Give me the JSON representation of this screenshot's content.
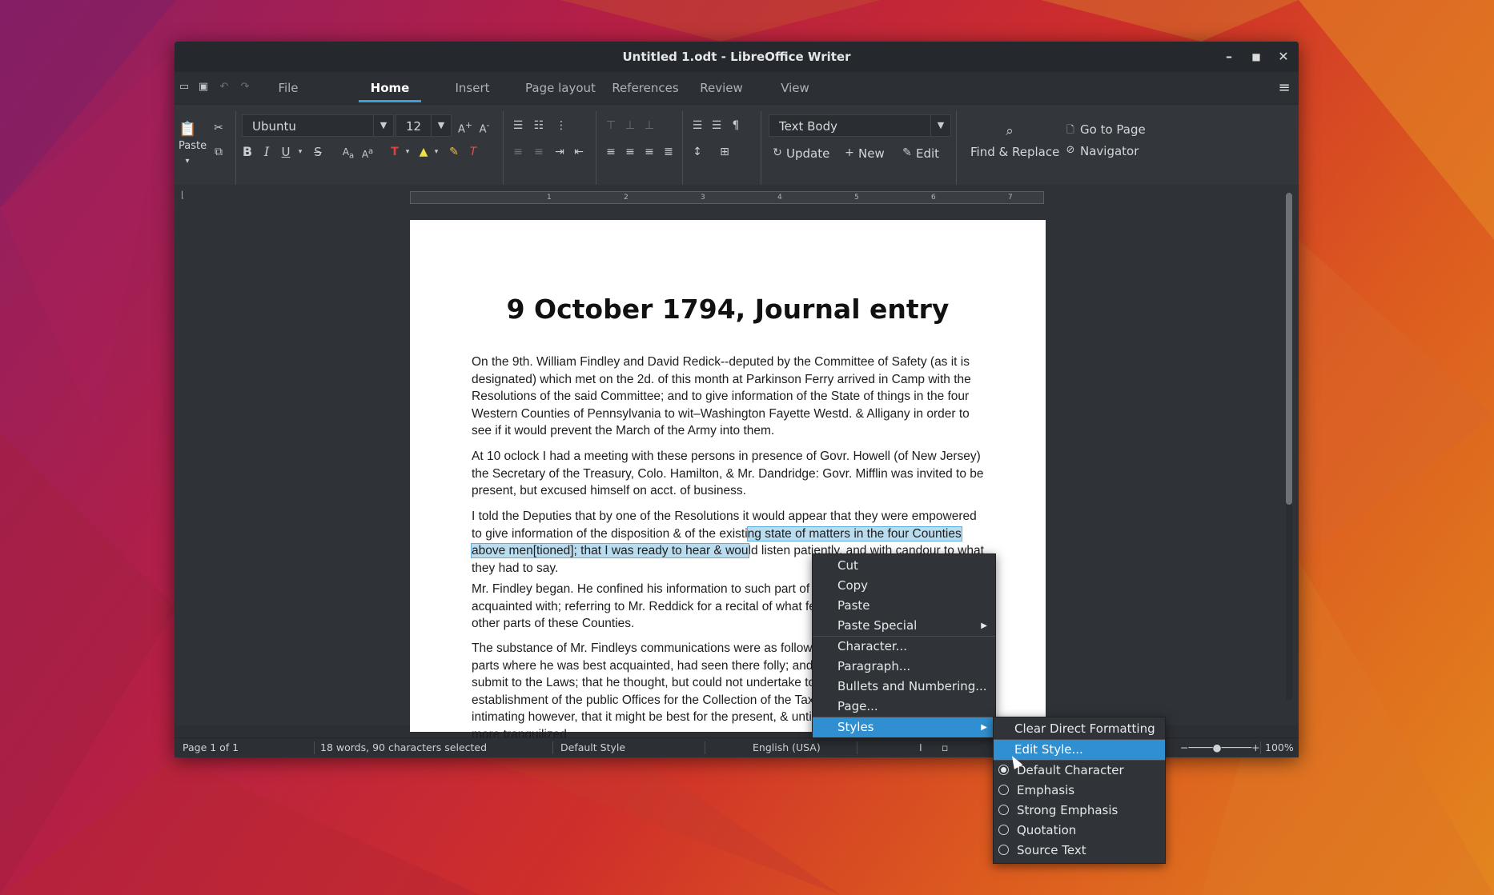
{
  "window": {
    "title": "Untitled 1.odt - LibreOffice Writer"
  },
  "tabs": [
    {
      "label": "File"
    },
    {
      "label": "Home"
    },
    {
      "label": "Insert"
    },
    {
      "label": "Page layout"
    },
    {
      "label": "References"
    },
    {
      "label": "Review"
    },
    {
      "label": "View"
    }
  ],
  "active_tab": "Home",
  "toolbar": {
    "paste_label": "Paste",
    "font_name": "Ubuntu",
    "font_size": "12",
    "paragraph_style": "Text Body",
    "update_label": "Update",
    "new_label": "New",
    "edit_label": "Edit",
    "find_replace_label": "Find & Replace",
    "go_to_page_label": "Go to Page",
    "navigator_label": "Navigator"
  },
  "ruler": {
    "numbers": [
      "1",
      "2",
      "3",
      "4",
      "5",
      "6",
      "7"
    ]
  },
  "document": {
    "title": "9 October 1794, Journal entry",
    "p1": "On the 9th. William Findley and David Redick--deputed by the Committee of Safety (as it is designated) which met on the 2d. of this month at Parkinson Ferry arrived in Camp with the Resolutions of the said Committee; and to give information of the State of things in the four Western Counties of Pennsylvania to wit–Washington Fayette Westd. & Alligany in order to see if it would prevent the March of the Army into them.",
    "p2": "At 10 oclock I had a meeting with these persons in presence of Govr. Howell (of New Jersey) the Secretary of the Treasury, Colo. Hamilton, & Mr. Dandridge: Govr. Mifflin was invited to be present, but excused himself on acct. of business.",
    "p3_before": "I told the Deputies that by one of the Resolutions it would appear that they were empowered to give information of the disposition & of the existi",
    "p3_selected": "ng state of matters in the four Counties above men[tioned]; that I was ready to hear & wou",
    "p3_after": "ld listen patiently, and with candour to what they had to say.",
    "p4": "Mr. Findley began. He confined his information to such part of the Country as he was best acquainted with; referring to Mr. Reddick for a recital of what fell within his knowledge, in the other parts of these Counties.",
    "p5": "The substance of Mr. Findleys communications were as follows–viz.–That the people in the parts where he was best acquainted, had seen there folly; and he believed were disposed to submit to the Laws; that he thought, but could not undertake to be responsible, for the re-establishment of the public Offices for the Collection of the Taxes on distilled spirits, & Stills--intimating however, that it might be best for the present, & until the peoples minds were a little more tranquilized"
  },
  "status": {
    "page": "Page 1 of 1",
    "words": "18 words, 90 characters selected",
    "page_style": "Default Style",
    "language": "English (USA)",
    "zoom": "100%"
  },
  "context_menu": {
    "items": [
      "Cut",
      "Copy",
      "Paste",
      "Paste Special",
      "Character...",
      "Paragraph...",
      "Bullets and Numbering...",
      "Page...",
      "Styles"
    ]
  },
  "styles_menu": {
    "items": [
      "Clear Direct Formatting",
      "Edit Style...",
      "Default Character",
      "Emphasis",
      "Strong Emphasis",
      "Quotation",
      "Source Text"
    ]
  }
}
